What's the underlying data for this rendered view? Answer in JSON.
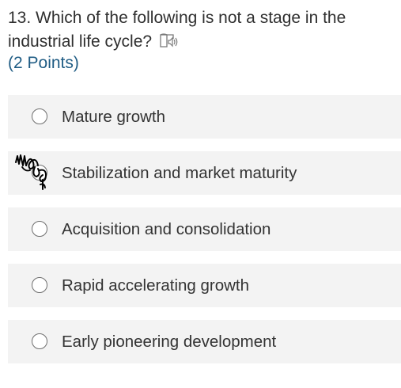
{
  "question": {
    "number": "13.",
    "line1": "Which of the following is not a stage in the",
    "line2": "industrial life cycle?",
    "points": "(2 Points)",
    "reader_icon": "immersive-reader-icon"
  },
  "options": [
    {
      "label": "Mature growth",
      "selected": false
    },
    {
      "label": "Stabilization and market maturity",
      "selected": false,
      "marked": true
    },
    {
      "label": "Acquisition and consolidation",
      "selected": false
    },
    {
      "label": "Rapid accelerating growth",
      "selected": false
    },
    {
      "label": "Early pioneering development",
      "selected": false
    }
  ],
  "colors": {
    "option_background": "#f3f3f3",
    "points_text": "#1f5c84",
    "question_text": "#2f2f2f",
    "radio_border": "#6e6e6e",
    "scribble_ink": "#000000"
  }
}
